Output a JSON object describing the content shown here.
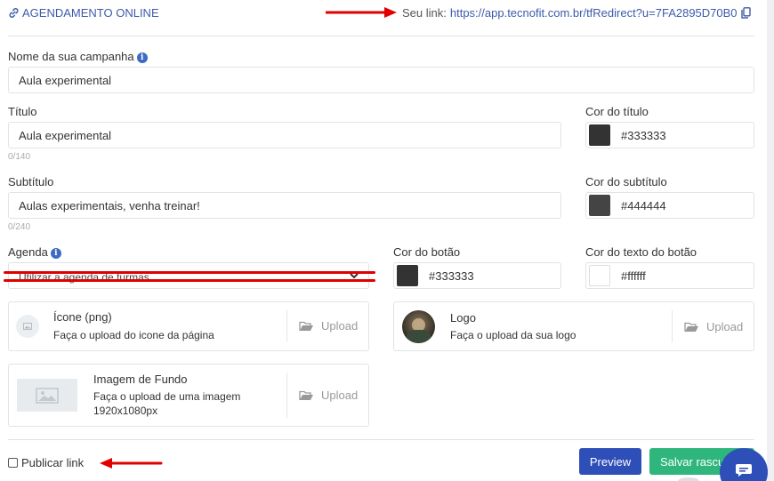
{
  "header": {
    "section_title": "AGENDAMENTO ONLINE",
    "link_label": "Seu link:",
    "link_url": "https://app.tecnofit.com.br/tfRedirect?u=7FA2895D70B0"
  },
  "form": {
    "campaign_label": "Nome da sua campanha",
    "campaign_value": "Aula experimental",
    "title_label": "Título",
    "title_value": "Aula experimental",
    "title_counter": "0/140",
    "title_color_label": "Cor do título",
    "title_color_value": "#333333",
    "subtitle_label": "Subtítulo",
    "subtitle_value": "Aulas experimentais, venha treinar!",
    "subtitle_counter": "0/240",
    "subtitle_color_label": "Cor do subtítulo",
    "subtitle_color_value": "#444444",
    "agenda_label": "Agenda",
    "agenda_selected": "Utilizar a agenda de turmas",
    "button_color_label": "Cor do botão",
    "button_color_value": "#333333",
    "button_text_color_label": "Cor do texto do botão",
    "button_text_color_value": "#ffffff"
  },
  "uploads": {
    "icon_title": "Ícone (png)",
    "icon_desc": "Faça o upload do icone da página",
    "logo_title": "Logo",
    "logo_desc": "Faça o upload da sua logo",
    "bg_title": "Imagem de Fundo",
    "bg_desc": "Faça o upload de uma imagem",
    "bg_size": "1920x1080px",
    "upload_label": "Upload"
  },
  "footer": {
    "publish_label": "Publicar link",
    "preview_label": "Preview",
    "save_draft_label": "Salvar rascu"
  },
  "colors": {
    "accent_blue": "#3d5ba9",
    "preview_button": "#2f4fb8",
    "save_button": "#2fb67c",
    "annotation_red": "#e00000",
    "chat_bubble": "#2f4fb8"
  }
}
